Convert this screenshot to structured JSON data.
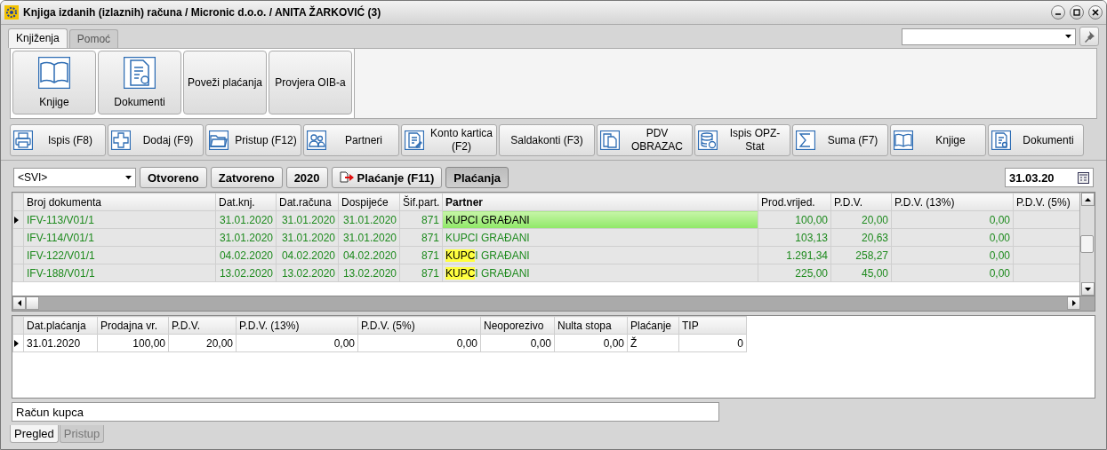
{
  "window": {
    "title": "Knjiga izdanih (izlaznih) računa / Micronic d.o.o. / ANITA ŽARKOVIĆ (3)"
  },
  "ribbon_tabs": [
    {
      "label": "Knjiženja",
      "selected": true
    },
    {
      "label": "Pomoć",
      "selected": false
    }
  ],
  "ribbon_buttons": [
    "Knjige",
    "Dokumenti",
    "Poveži plaćanja",
    "Provjera OIB-a"
  ],
  "toolbar": [
    {
      "label": "Ispis (F8)"
    },
    {
      "label": "Dodaj (F9)"
    },
    {
      "label": "Pristup (F12)"
    },
    {
      "label": "Partneri"
    },
    {
      "label": "Konto kartica (F2)"
    },
    {
      "label": "Saldakonti (F3)"
    },
    {
      "label": "PDV OBRAZAC"
    },
    {
      "label": "Ispis OPZ-Stat"
    },
    {
      "label": "Suma (F7)"
    },
    {
      "label": "Knjige"
    },
    {
      "label": "Dokumenti"
    }
  ],
  "filter": {
    "combo": "<SVI>",
    "buttons": [
      {
        "label": "Otvoreno",
        "selected": false
      },
      {
        "label": "Zatvoreno",
        "selected": false
      },
      {
        "label": "2020",
        "selected": false
      },
      {
        "label": "Plaćanje (F11)",
        "selected": false,
        "kind": "action"
      },
      {
        "label": "Plaćanja",
        "selected": true
      }
    ],
    "date": "31.03.20"
  },
  "table": {
    "columns": [
      "Broj dokumenta",
      "Dat.knj.",
      "Dat.računa",
      "Dospijeće",
      "Šif.part.",
      "Partner",
      "Prod.vrijed.",
      "P.D.V.",
      "P.D.V. (13%)",
      "P.D.V. (5%)"
    ],
    "rows": [
      {
        "selected": true,
        "cells": [
          "IFV-113/V01/1",
          "31.01.2020",
          "31.01.2020",
          "31.01.2020",
          "871",
          null,
          "100,00",
          "20,00",
          "0,00"
        ],
        "partner": [
          {
            "text": "KUPCI GRAĐANI",
            "highlight": false
          }
        ]
      },
      {
        "selected": false,
        "cells": [
          "IFV-114/V01/1",
          "31.01.2020",
          "31.01.2020",
          "31.01.2020",
          "871",
          null,
          "103,13",
          "20,63",
          "0,00"
        ],
        "partner": [
          {
            "text": "KUPCI GRAĐANI",
            "highlight": false
          }
        ]
      },
      {
        "selected": false,
        "cells": [
          "IFV-122/V01/1",
          "04.02.2020",
          "04.02.2020",
          "04.02.2020",
          "871",
          null,
          "1.291,34",
          "258,27",
          "0,00"
        ],
        "partner": [
          {
            "text": "KUPC",
            "highlight": true
          },
          {
            "text": "I GRAĐANI",
            "highlight": false
          }
        ]
      },
      {
        "selected": false,
        "cells": [
          "IFV-188/V01/1",
          "13.02.2020",
          "13.02.2020",
          "13.02.2020",
          "871",
          null,
          "225,00",
          "45,00",
          "0,00"
        ],
        "partner": [
          {
            "text": "KUPC",
            "highlight": true
          },
          {
            "text": "I GRAĐANI",
            "highlight": false
          }
        ]
      }
    ]
  },
  "payments": {
    "columns": [
      "Dat.plaćanja",
      "Prodajna vr.",
      "P.D.V.",
      "P.D.V. (13%)",
      "P.D.V. (5%)",
      "Neoporezivo",
      "Nulta stopa",
      "Plaćanje",
      "TIP"
    ],
    "rows": [
      {
        "selected": true,
        "cells": [
          "31.01.2020",
          "100,00",
          "20,00",
          "0,00",
          "0,00",
          "0,00",
          "0,00",
          "Ž",
          "0"
        ]
      }
    ]
  },
  "note": "Račun kupca",
  "bottom_tabs": [
    {
      "label": "Pregled",
      "selected": true
    },
    {
      "label": "Pristup",
      "selected": false
    }
  ]
}
